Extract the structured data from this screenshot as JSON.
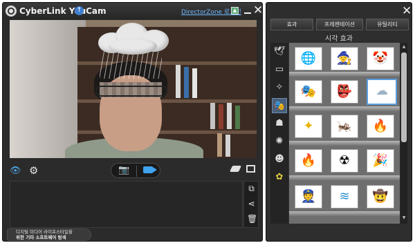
{
  "left_window": {
    "title": "CyberLink YouCam",
    "update_label": "↑",
    "directorzone_link": "DirectorZone 로그인",
    "close_label": "✕",
    "promo": {
      "line1": "디지털 미디어 라이프스타일을",
      "line2": "위한 기타 소프트웨어 탐색"
    }
  },
  "right_window": {
    "close_label": "✕",
    "tabs": [
      {
        "label": "효과"
      },
      {
        "label": "프레젠테이션"
      },
      {
        "label": "유틸리티"
      }
    ],
    "panel_title": "시각 효과",
    "categories": [
      {
        "icon": "bird-icon"
      },
      {
        "icon": "frame-icon"
      },
      {
        "icon": "sparkle-icon"
      },
      {
        "icon": "mask-icon",
        "active": true
      },
      {
        "icon": "costume-icon"
      },
      {
        "icon": "splash-icon"
      },
      {
        "icon": "smiley-icon"
      },
      {
        "icon": "flower-icon"
      }
    ],
    "effects": [
      [
        {
          "name": "globe-arrow"
        },
        {
          "name": "witch-hat"
        },
        {
          "name": "clown"
        }
      ],
      [
        {
          "name": "venetian-mask"
        },
        {
          "name": "opera-mask"
        },
        {
          "name": "rain-cloud",
          "selected": true
        }
      ],
      [
        {
          "name": "stars"
        },
        {
          "name": "green-bug"
        },
        {
          "name": "flames"
        }
      ],
      [
        {
          "name": "fire"
        },
        {
          "name": "gas-mask"
        },
        {
          "name": "party-hat"
        }
      ],
      [
        {
          "name": "police-cap"
        },
        {
          "name": "blue-waves"
        },
        {
          "name": "cowboy-hat"
        }
      ]
    ]
  }
}
